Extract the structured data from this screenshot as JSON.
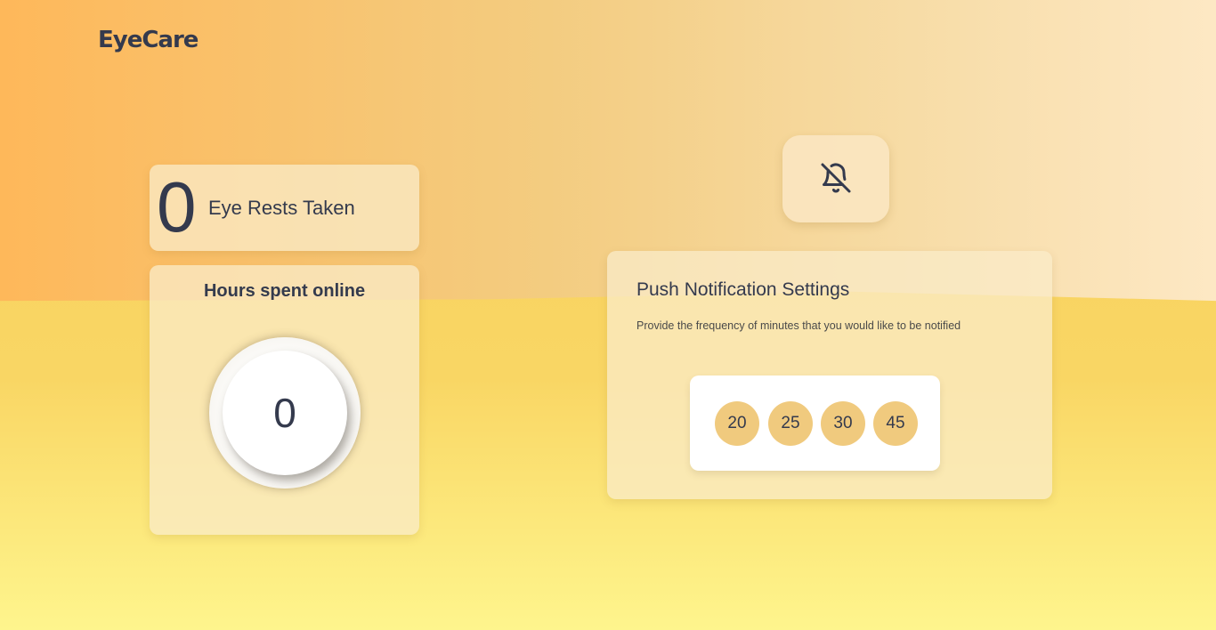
{
  "app": {
    "logo": "EyeCare"
  },
  "rests": {
    "count": "0",
    "label": "Eye Rests Taken"
  },
  "hours": {
    "title": "Hours spent online",
    "value": "0"
  },
  "notifications": {
    "bell_icon": "bell-off-icon",
    "title": "Push Notification Settings",
    "description": "Provide the frequency of minutes that you would like to be notified",
    "options": [
      "20",
      "25",
      "30",
      "45"
    ]
  },
  "colors": {
    "text": "#343a4d",
    "option_bg": "#f0ca7e",
    "card_bg": "#faebc8"
  }
}
